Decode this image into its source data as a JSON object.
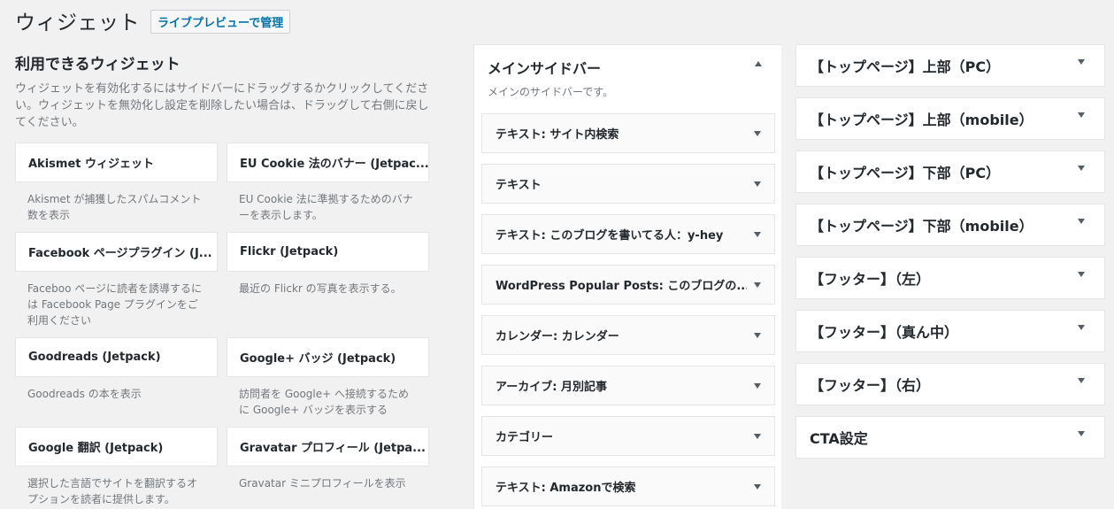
{
  "header": {
    "title": "ウィジェット",
    "live_preview_label": "ライブプレビューで管理"
  },
  "available": {
    "heading": "利用できるウィジェット",
    "description": "ウィジェットを有効化するにはサイドバーにドラッグするかクリックしてください。ウィジェットを無効化し設定を削除したい場合は、ドラッグして右側に戻してください。",
    "widgets": [
      {
        "name": "Akismet ウィジェット",
        "desc": "Akismet が捕獲したスパムコメント数を表示"
      },
      {
        "name": "EU Cookie 法のバナー (Jetpac...",
        "desc": "EU Cookie 法に準拠するためのバナーを表示します。"
      },
      {
        "name": "Facebook ページプラグイン (J...",
        "desc": "Faceboo ページに読者を誘導するには Facebook Page プラグインをご利用ください"
      },
      {
        "name": "Flickr (Jetpack)",
        "desc": "最近の Flickr の写真を表示する。"
      },
      {
        "name": "Goodreads (Jetpack)",
        "desc": "Goodreads の本を表示"
      },
      {
        "name": "Google+ バッジ (Jetpack)",
        "desc": "訪問者を Google+ へ接続するために Google+ バッジを表示する"
      },
      {
        "name": "Google 翻訳 (Jetpack)",
        "desc": "選択した言語でサイトを翻訳するオプションを読者に提供します。"
      },
      {
        "name": "Gravatar プロフィール (Jetpa...",
        "desc": "Gravatar ミニプロフィールを表示"
      }
    ]
  },
  "main_sidebar": {
    "title": "メインサイドバー",
    "description": "メインのサイドバーです。",
    "widgets": [
      "テキスト: サイト内検索",
      "テキスト",
      "テキスト: このブログを書いてる人：y-hey",
      "WordPress Popular Posts: このブログの...",
      "カレンダー: カレンダー",
      "アーカイブ: 月別記事",
      "カテゴリー",
      "テキスト: Amazonで検索"
    ]
  },
  "widget_areas": [
    "【トップページ】上部（PC）",
    "【トップページ】上部（mobile）",
    "【トップページ】下部（PC）",
    "【トップページ】下部（mobile）",
    "【フッター】（左）",
    "【フッター】（真ん中）",
    "【フッター】（右）",
    "CTA設定"
  ],
  "colors": {
    "background": "#f1f1f1",
    "link": "#0073aa",
    "text": "#23282d",
    "muted": "#72777c"
  }
}
